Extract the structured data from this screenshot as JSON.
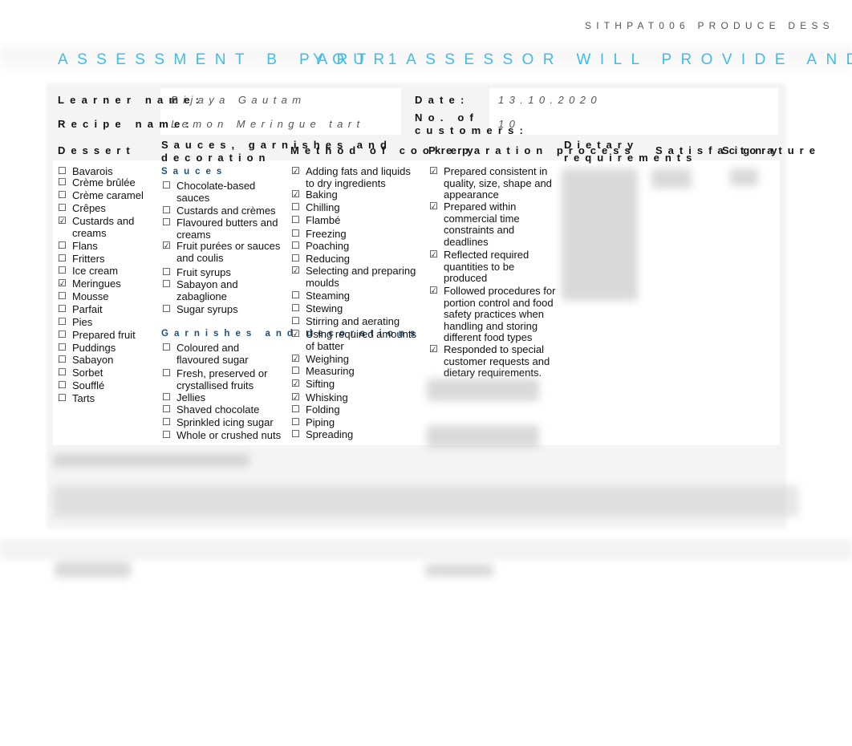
{
  "header": {
    "running_head": "SITHPAT006 PRODUCE DESS",
    "title_part_a": "ASSESSMENT B PART 1",
    "title_part_b": "YOUR ASSESSOR WILL PROVIDE AND MA"
  },
  "form": {
    "learner_label": "Learner name:",
    "learner_value": "Bijaya Gautam",
    "recipe_label": "Recipe name:",
    "recipe_value": "Lemon Meringue tart",
    "date_label": "Date:",
    "date_value": "13.10.2020",
    "customers_label_line1": "No. of",
    "customers_label_line2": "customers:",
    "customers_value": "10"
  },
  "columns": {
    "dessert": "Dessert",
    "sauces_line1": "Sauces, garnishes and",
    "sauces_line2": "decoration",
    "method": "Method of cookery",
    "preparation": "Preparation process",
    "dietary_line1": "Dietary",
    "dietary_line2": "requirements",
    "satisfactory": "Satisfactory",
    "signature": "Signature"
  },
  "dessert_items": [
    {
      "label": "Bavarois",
      "checked": false
    },
    {
      "label": "Crème brûlée",
      "checked": false
    },
    {
      "label": "Crème caramel",
      "checked": false
    },
    {
      "label": "Crêpes",
      "checked": false
    },
    {
      "label": "Custards and creams",
      "checked": true
    },
    {
      "label": "Flans",
      "checked": false
    },
    {
      "label": "Fritters",
      "checked": false
    },
    {
      "label": "Ice cream",
      "checked": false
    },
    {
      "label": "Meringues",
      "checked": true
    },
    {
      "label": "Mousse",
      "checked": false
    },
    {
      "label": "Parfait",
      "checked": false
    },
    {
      "label": "Pies",
      "checked": false
    },
    {
      "label": "Prepared fruit",
      "checked": false
    },
    {
      "label": "Puddings",
      "checked": false
    },
    {
      "label": "Sabayon",
      "checked": false
    },
    {
      "label": "Sorbet",
      "checked": false
    },
    {
      "label": "Soufflé",
      "checked": false
    },
    {
      "label": "Tarts",
      "checked": false
    }
  ],
  "sauces_heading": "Sauces",
  "sauce_items": [
    {
      "label": "Chocolate-based sauces",
      "checked": false
    },
    {
      "label": "Custards and crèmes",
      "checked": false
    },
    {
      "label": "Flavoured butters and creams",
      "checked": false
    },
    {
      "label": "Fruit purées or sauces and coulis",
      "checked": true
    },
    {
      "label": "Fruit syrups",
      "checked": false
    },
    {
      "label": "Sabayon and zabaglione",
      "checked": false
    },
    {
      "label": "Sugar syrups",
      "checked": false
    }
  ],
  "garnishes_heading": "Garnishes and decorations",
  "garnish_items": [
    {
      "label": "Coloured and flavoured sugar",
      "checked": false
    },
    {
      "label": "Fresh, preserved or crystallised fruits",
      "checked": false
    },
    {
      "label": "Jellies",
      "checked": false
    },
    {
      "label": "Shaved chocolate",
      "checked": false
    },
    {
      "label": "Sprinkled icing sugar",
      "checked": false
    },
    {
      "label": "Whole or crushed nuts",
      "checked": false
    }
  ],
  "method_items": [
    {
      "label": "Adding fats and liquids to dry ingredients",
      "checked": true
    },
    {
      "label": "Baking",
      "checked": true
    },
    {
      "label": "Chilling",
      "checked": false
    },
    {
      "label": "Flambé",
      "checked": false
    },
    {
      "label": "Freezing",
      "checked": false
    },
    {
      "label": "Poaching",
      "checked": false
    },
    {
      "label": "Reducing",
      "checked": false
    },
    {
      "label": "Selecting and preparing moulds",
      "checked": true
    },
    {
      "label": "Steaming",
      "checked": false
    },
    {
      "label": "Stewing",
      "checked": false
    },
    {
      "label": "Stirring and aerating",
      "checked": false
    },
    {
      "label": "Using required amounts of batter",
      "checked": true
    },
    {
      "label": "Weighing",
      "checked": true
    },
    {
      "label": "Measuring",
      "checked": false
    },
    {
      "label": "Sifting",
      "checked": true
    },
    {
      "label": "Whisking",
      "checked": true
    },
    {
      "label": "Folding",
      "checked": false
    },
    {
      "label": "Piping",
      "checked": false
    },
    {
      "label": "Spreading",
      "checked": false
    }
  ],
  "preparation_items": [
    {
      "label": "Prepared consistent in quality, size, shape and appearance",
      "checked": true
    },
    {
      "label": "Prepared within commercial time constraints and deadlines",
      "checked": true
    },
    {
      "label": "Reflected required quantities to be produced",
      "checked": true
    },
    {
      "label": "Followed procedures for portion control and food safety practices when handling and storing different food types",
      "checked": true
    },
    {
      "label": "Responded to special customer requests and dietary requirements.",
      "checked": true
    }
  ],
  "checkbox_glyphs": {
    "checked": "☑",
    "unchecked": "☐"
  },
  "colors": {
    "title": "#3dbde8",
    "subheading": "#1d4f7c"
  }
}
